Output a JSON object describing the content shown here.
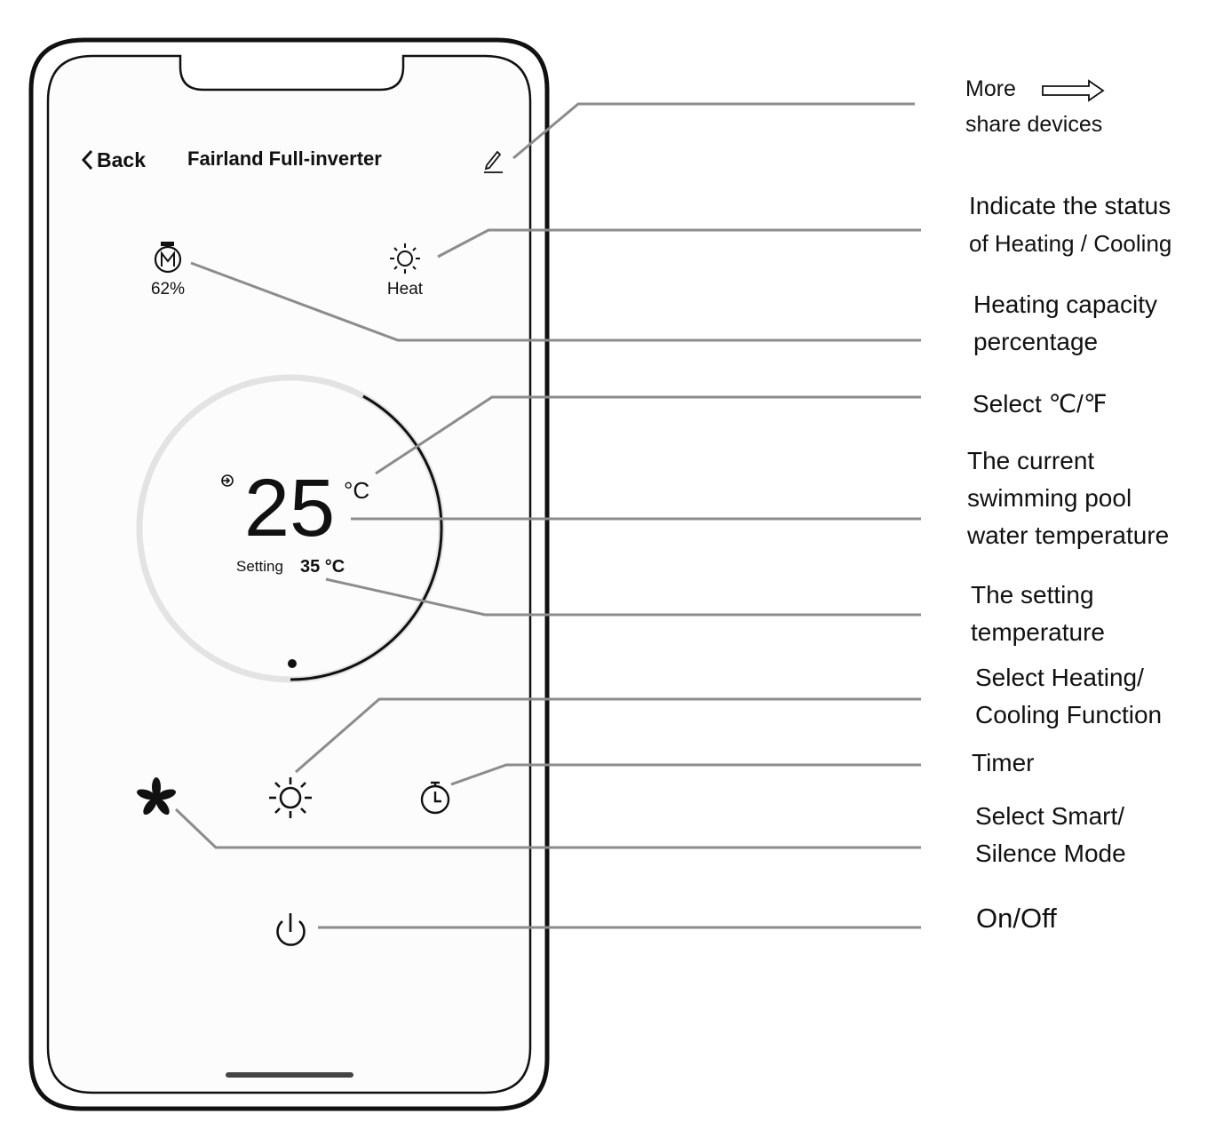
{
  "app": {
    "back_label": "Back",
    "title": "Fairland Full-inverter",
    "edit_icon": "pencil-icon"
  },
  "status": {
    "capacity_value": "62%",
    "capacity_icon": "compressor-icon",
    "mode_label": "Heat",
    "mode_icon": "sun-icon"
  },
  "dial": {
    "current_temp": "25",
    "unit": "°C",
    "setting_label": "Setting",
    "setting_value": "35 °C",
    "water_icon": "water-inlet-icon",
    "progress_fraction": 0.42
  },
  "controls": {
    "fan_icon": "fan-icon",
    "mode_icon": "sun-icon",
    "timer_icon": "timer-icon",
    "power_icon": "power-icon"
  },
  "annotations": {
    "more_line1": "More",
    "more_line2": "share devices",
    "status_line1": "Indicate the status",
    "status_line2": "of Heating / Cooling",
    "capacity_line1": "Heating capacity",
    "capacity_line2": "percentage",
    "unit_select": "Select ℃/℉",
    "current_line1": "The current",
    "current_line2": "swimming pool",
    "current_line3": "water temperature",
    "setting_line1": "The setting",
    "setting_line2": "temperature",
    "function_line1": "Select Heating/",
    "function_line2": "Cooling Function",
    "timer": "Timer",
    "smart_line1": "Select Smart/",
    "smart_line2": "Silence Mode",
    "onoff": "On/Off"
  },
  "colors": {
    "frame": "#111111",
    "leader": "#8c8c8c",
    "track": "#e3e3e3",
    "ink": "#111111"
  }
}
